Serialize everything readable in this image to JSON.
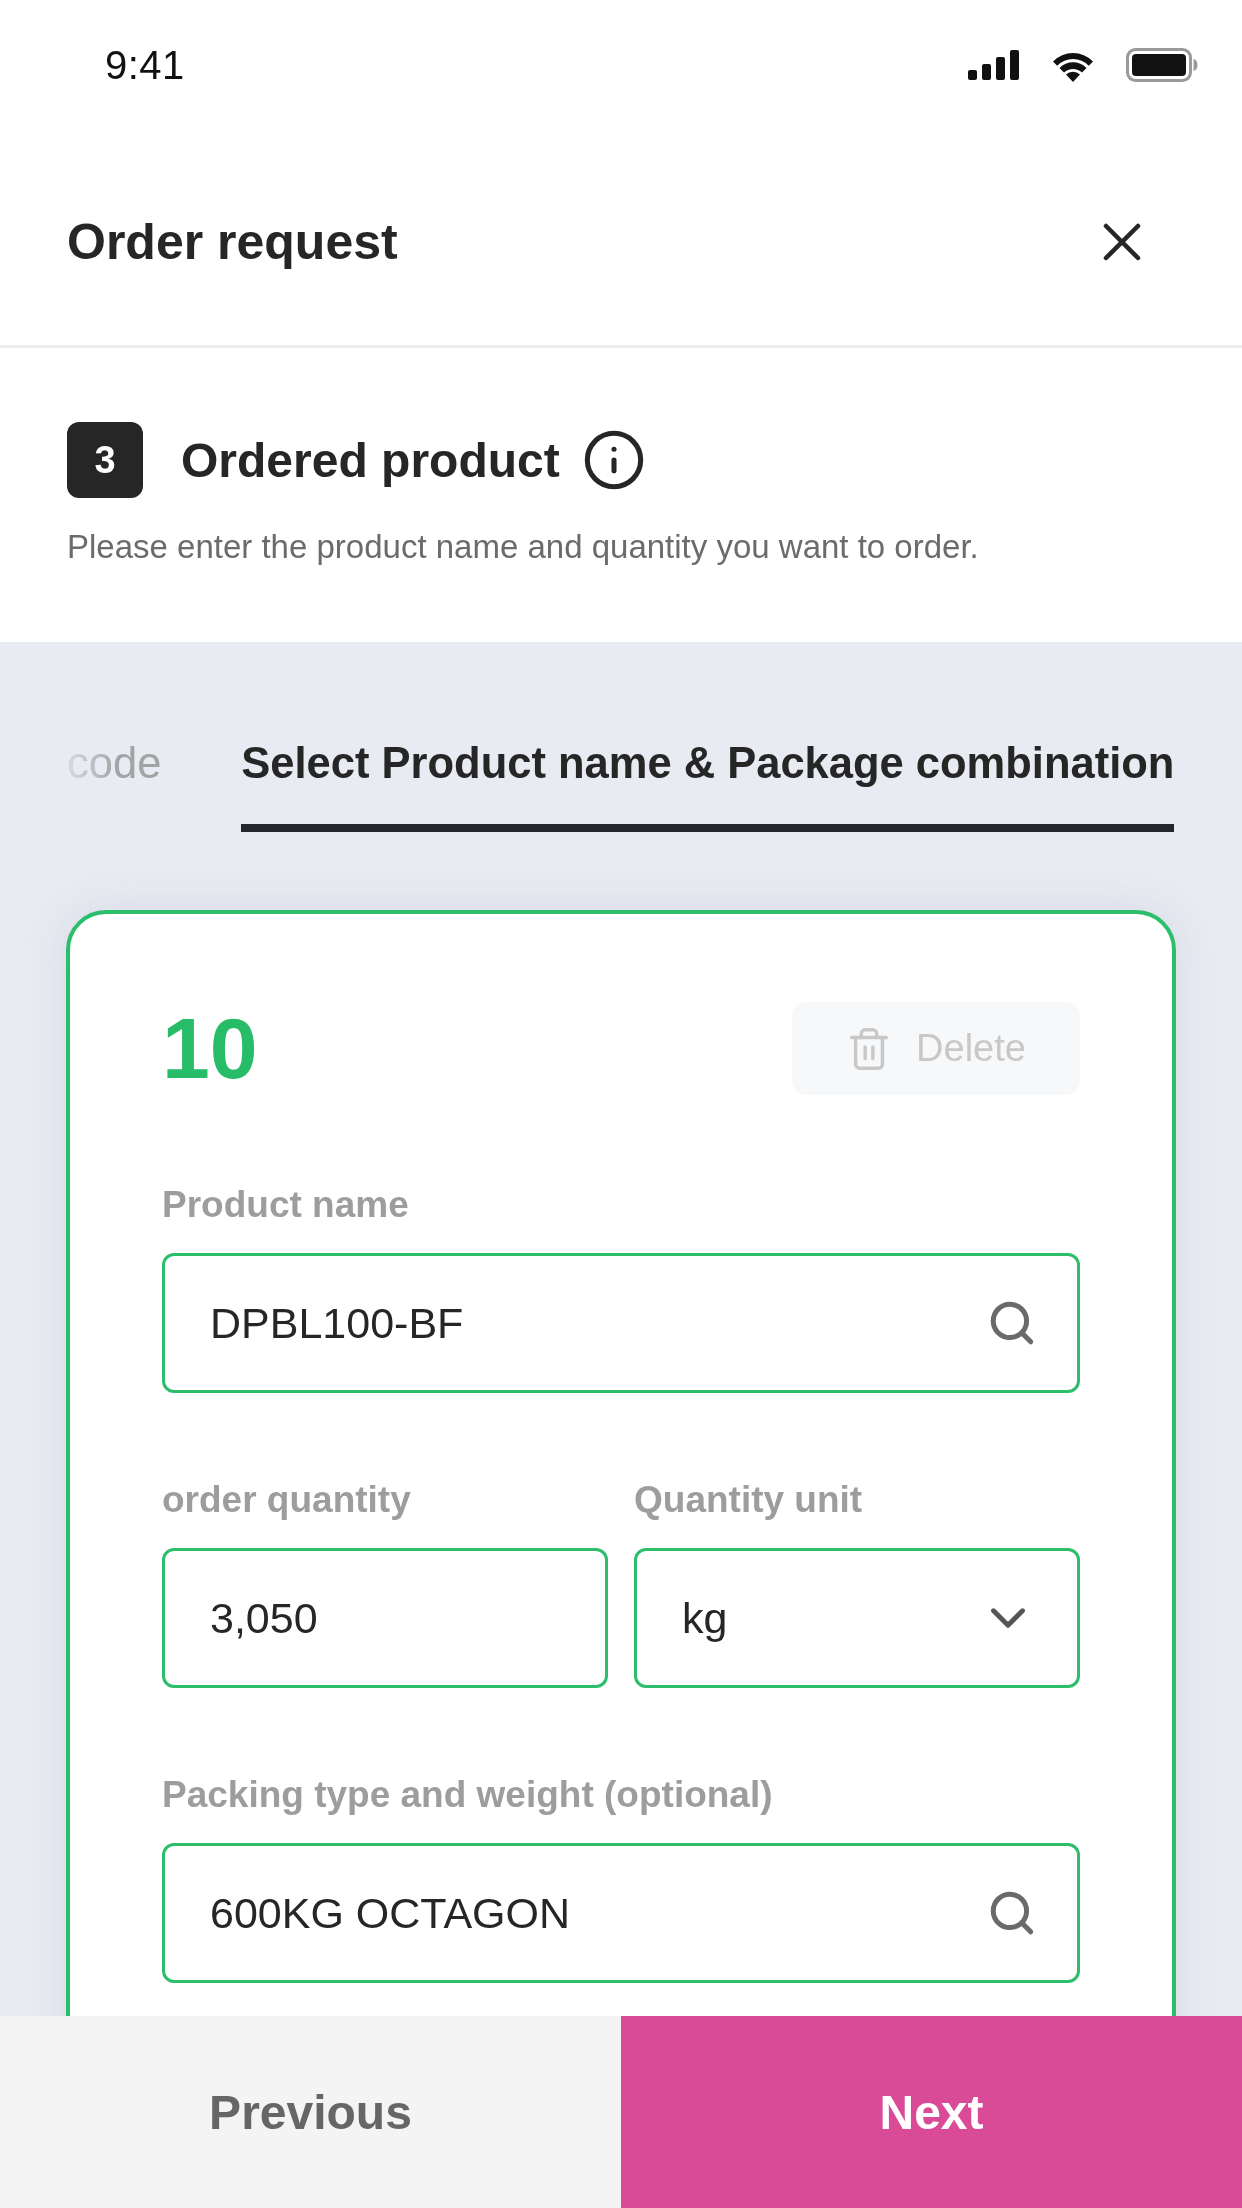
{
  "status_bar": {
    "time": "9:41"
  },
  "header": {
    "title": "Order request"
  },
  "step": {
    "number": "3",
    "title": "Ordered product",
    "description": "Please enter the product name and quantity you want to order."
  },
  "tabs": [
    {
      "label": "code",
      "selected": false
    },
    {
      "label": "Select Product name & Package combination",
      "selected": true
    }
  ],
  "order_item": {
    "number": "10",
    "delete_button": {
      "label": "Delete",
      "disabled": true
    },
    "field_rows": [
      {
        "fields": [
          {
            "kind": "search",
            "label": "Product name",
            "value": "DPBL100-BF"
          }
        ]
      },
      {
        "fields": [
          {
            "kind": "text",
            "label": "order quantity",
            "value": "3,050"
          },
          {
            "kind": "dropdown",
            "label": "Quantity unit",
            "value": "kg"
          }
        ]
      },
      {
        "fields": [
          {
            "kind": "search",
            "label": "Packing type and weight (optional)",
            "value": "600KG OCTAGON"
          }
        ]
      }
    ]
  },
  "footer": {
    "buttons": [
      {
        "kind": "secondary",
        "label": "Previous"
      },
      {
        "kind": "primary",
        "label": "Next"
      }
    ]
  }
}
